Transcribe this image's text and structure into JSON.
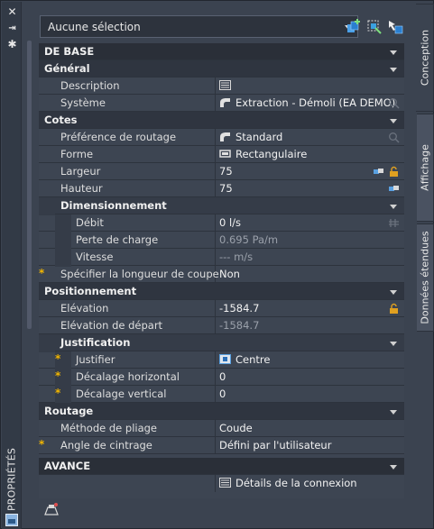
{
  "window": {
    "vertical_title": "PROPRIÉTÉS"
  },
  "selection": {
    "value": "Aucune sélection"
  },
  "tabs": [
    {
      "label": "Conception"
    },
    {
      "label": "Affichage"
    },
    {
      "label": "Données étendues"
    }
  ],
  "categories": {
    "de_base": "DE BASE",
    "general": "Général",
    "cotes": "Cotes",
    "dimensionnement": "Dimensionnement",
    "positionnement": "Positionnement",
    "justification": "Justification",
    "routage": "Routage",
    "avance": "AVANCE"
  },
  "props": {
    "description": {
      "label": "Description",
      "value": ""
    },
    "systeme": {
      "label": "Système",
      "value": "Extraction - Démoli (EA DEMO)"
    },
    "pref_routage": {
      "label": "Préférence de routage",
      "value": "Standard"
    },
    "forme": {
      "label": "Forme",
      "value": "Rectangulaire"
    },
    "largeur": {
      "label": "Largeur",
      "value": "75"
    },
    "hauteur": {
      "label": "Hauteur",
      "value": "75"
    },
    "debit": {
      "label": "Débit",
      "value": "0 l/s"
    },
    "perte": {
      "label": "Perte de charge",
      "value": "0.695 Pa/m"
    },
    "vitesse": {
      "label": "Vitesse",
      "value": "--- m/s"
    },
    "longueur": {
      "label": "Spécifier la longueur de coupe",
      "value": "Non"
    },
    "elevation": {
      "label": "Elévation",
      "value": "-1584.7"
    },
    "elev_depart": {
      "label": "Elévation de départ",
      "value": "-1584.7"
    },
    "justifier": {
      "label": "Justifier",
      "value": "Centre"
    },
    "decal_h": {
      "label": "Décalage horizontal",
      "value": "0"
    },
    "decal_v": {
      "label": "Décalage vertical",
      "value": "0"
    },
    "methode": {
      "label": "Méthode de pliage",
      "value": "Coude"
    },
    "angle": {
      "label": "Angle de cintrage",
      "value": "Défini par l'utilisateur"
    },
    "details": {
      "value": "Détails de la connexion"
    }
  },
  "colors": {
    "required_marker": "#f2b600",
    "lock": "#e0a020",
    "link": "#5aa0e0"
  }
}
